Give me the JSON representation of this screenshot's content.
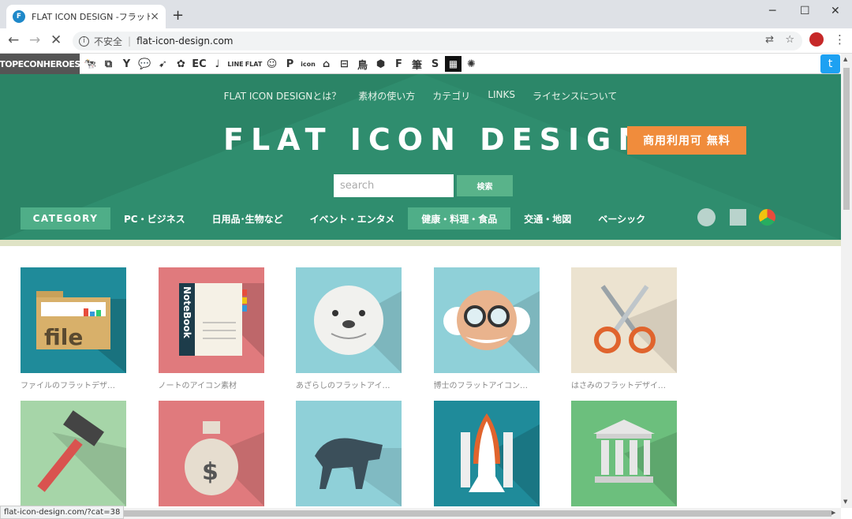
{
  "browser": {
    "tab_title": "FLAT ICON DESIGN -フラットデザインのアイコン素材サイト-",
    "new_tab": "+",
    "close_tab": "×",
    "security_label": "不安全",
    "url": "flat-icon-design.com",
    "window_controls": [
      "─",
      "☐",
      "✕"
    ],
    "status_url": "flat-icon-design.com/?cat=38"
  },
  "heroes_bar": {
    "logo": "TOPECONHEROES",
    "icons": [
      "🐄",
      "⧉",
      "Y",
      "💬",
      "➹",
      "✿",
      "EC",
      "♩",
      "LINE",
      "FLAT",
      "☺",
      "P",
      "icon",
      "⌂",
      "⊟",
      "鳥",
      "⬢",
      "F",
      "筆",
      "S",
      "▦",
      "✺"
    ]
  },
  "header": {
    "nav": [
      "FLAT ICON DESIGNとは？",
      "素材の使い方",
      "カテゴリ",
      "LINKS",
      "ライセンスについて"
    ],
    "title": "FLAT ICON DESIGN",
    "badge": "商用利用可 無料",
    "search_placeholder": "search",
    "search_button": "検索",
    "category_label": "CATEGORY",
    "categories": [
      "PC・ビジネス",
      "日用品･生物など",
      "イベント・エンタメ",
      "健康・料理・食品",
      "交通・地図",
      "ベーシック"
    ]
  },
  "icons": [
    {
      "caption": "ファイルのフラットデザ…",
      "color": "#1f8b9a",
      "label": "file"
    },
    {
      "caption": "ノートのアイコン素材",
      "color": "#e07a7d",
      "label": "NoteBook"
    },
    {
      "caption": "あざらしのフラットアイ…",
      "color": "#8fd0d8"
    },
    {
      "caption": "博士のフラットアイコン…",
      "color": "#8fd0d8"
    },
    {
      "caption": "はさみのフラットデザイ…",
      "color": "#ece3d0"
    },
    {
      "caption": "",
      "color": "#a6d5a8"
    },
    {
      "caption": "",
      "color": "#e07a7d",
      "label": "$"
    },
    {
      "caption": "",
      "color": "#8fd0d8"
    },
    {
      "caption": "",
      "color": "#1f8b9a"
    },
    {
      "caption": "",
      "color": "#6cbf7d"
    }
  ]
}
